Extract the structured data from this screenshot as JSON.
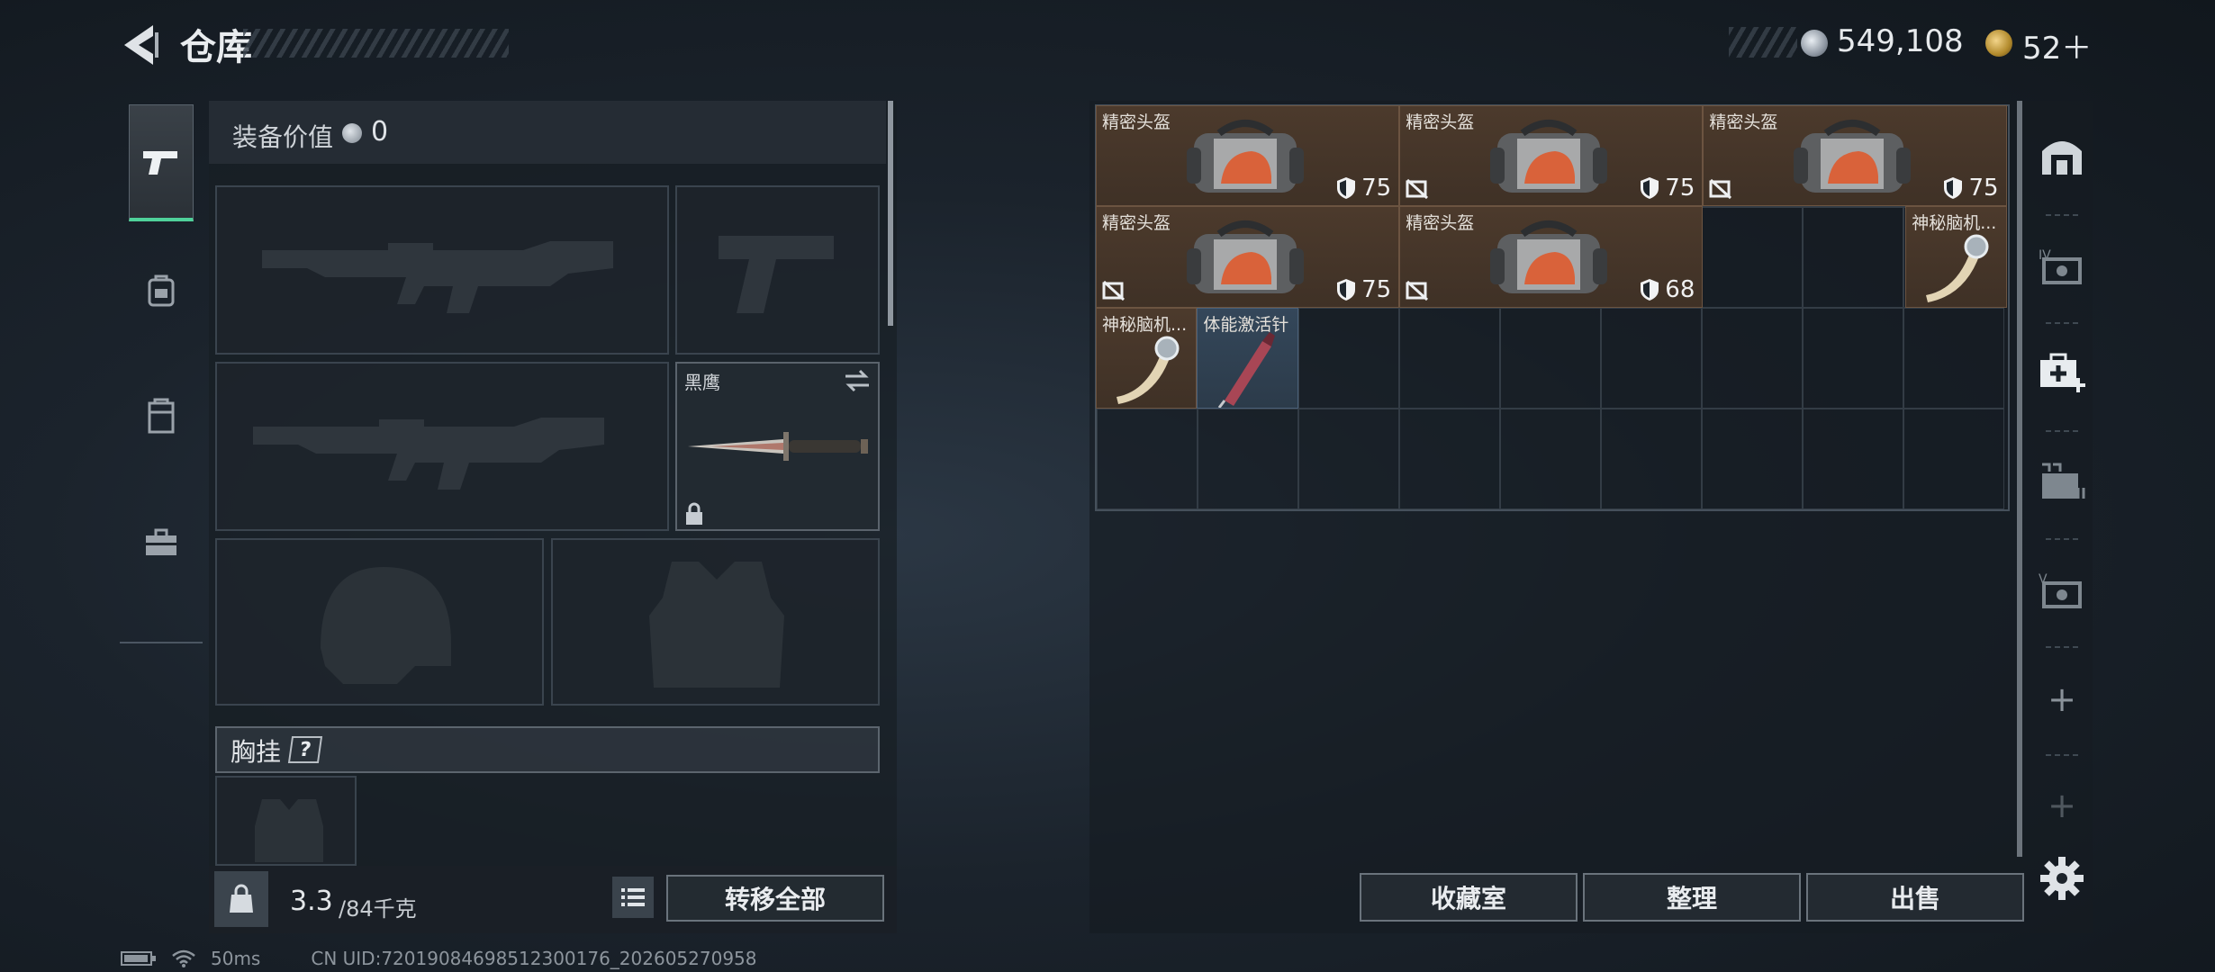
{
  "header": {
    "title": "仓库"
  },
  "currency": {
    "coins": "549,108",
    "tickets": "52＋"
  },
  "equipment": {
    "value_label": "装备价值",
    "value": "0",
    "melee_name": "黑鹰",
    "vest_label": "胸挂",
    "help_mark": "?",
    "weight_current": "3.3",
    "weight_max": "/84千克",
    "transfer_all": "转移全部"
  },
  "storage": {
    "items": [
      {
        "name": "精密头盔",
        "durability": "75",
        "no_armor": false
      },
      {
        "name": "精密头盔",
        "durability": "75",
        "no_armor": true
      },
      {
        "name": "精密头盔",
        "durability": "75",
        "no_armor": true
      },
      {
        "name": "精密头盔",
        "durability": "75",
        "no_armor": true
      },
      {
        "name": "精密头盔",
        "durability": "68",
        "no_armor": true
      },
      {
        "name": "神秘脑机..."
      },
      {
        "name": "神秘脑机..."
      },
      {
        "name": "体能激活针"
      }
    ],
    "buttons": {
      "collection": "收藏室",
      "sort": "整理",
      "sell": "出售"
    }
  },
  "status_bar": {
    "ping": "50ms",
    "uid": "CN UID:72019084698512300176_202605270958"
  },
  "colors": {
    "accent_green": "#4fd19a",
    "item_brown": "#4c3a2c",
    "item_blue": "#34475a"
  }
}
